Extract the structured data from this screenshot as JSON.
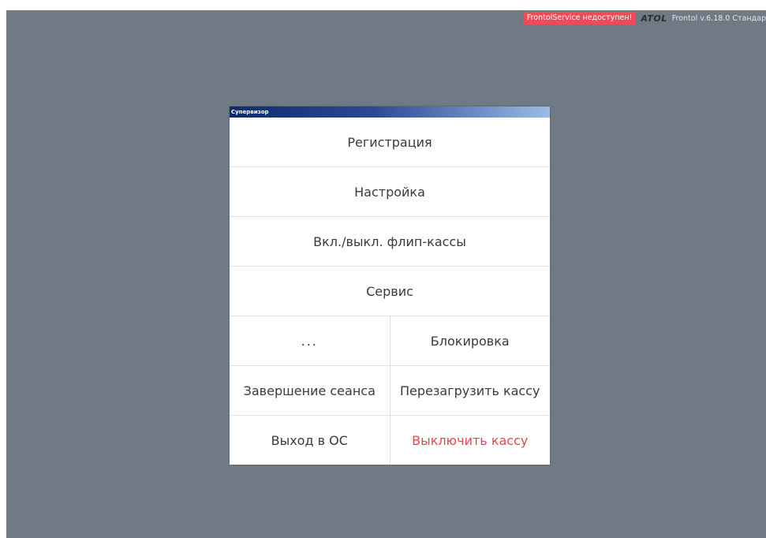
{
  "status_bar": {
    "service_status": "FrontolService недоступен!",
    "brand_logo": "ATOL",
    "version_text": "Frontol v.6.18.0 Стандар"
  },
  "dialog": {
    "title": "Супервизор",
    "buttons": {
      "registration": "Регистрация",
      "settings": "Настройка",
      "flip_register": "Вкл./выкл. флип-кассы",
      "service": "Сервис",
      "more": "...",
      "lock": "Блокировка",
      "end_session": "Завершение сеанса",
      "restart_register": "Перезагрузить кассу",
      "exit_os": "Выход в ОС",
      "shutdown_register": "Выключить кассу"
    }
  },
  "colors": {
    "background": "#6f7a85",
    "service_badge": "#ee4b56",
    "danger_text": "#e64550"
  }
}
